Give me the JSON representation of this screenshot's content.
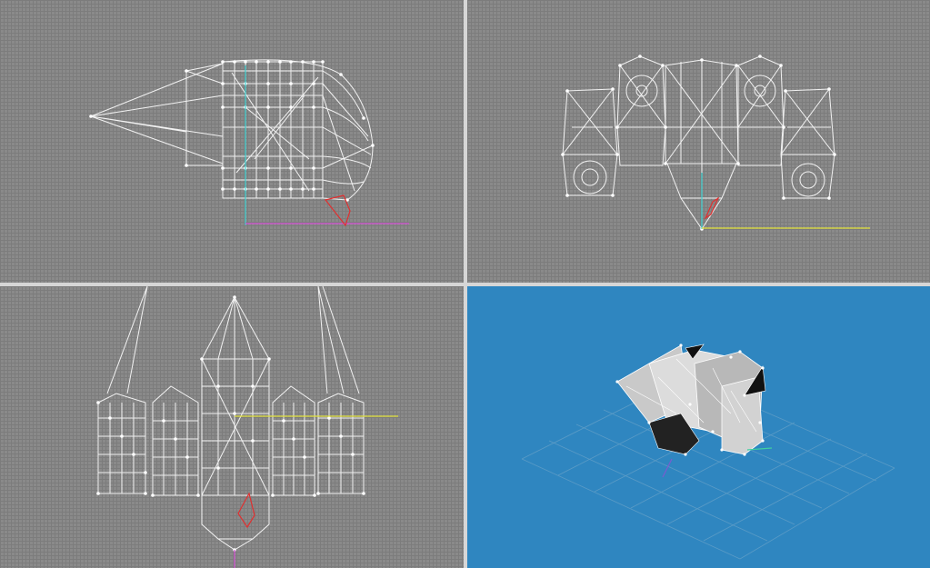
{
  "viewports": [
    {
      "id": "side-view",
      "kind": "orthographic"
    },
    {
      "id": "front-view",
      "kind": "orthographic"
    },
    {
      "id": "top-view",
      "kind": "orthographic"
    },
    {
      "id": "perspective-view",
      "kind": "perspective"
    }
  ],
  "colors": {
    "ortho_background": "#8a8a8a",
    "ortho_grid": "#7c7c7c",
    "perspective_background": "#2f86c0",
    "perspective_grid": "#5a9bc6",
    "wireframe": "#ffffff",
    "axis_x": "#d34fd3",
    "axis_y": "#e0e03a",
    "axis_z": "#3fd0d0",
    "gizmo": "#e03030",
    "divider": "#d6d6d6"
  }
}
